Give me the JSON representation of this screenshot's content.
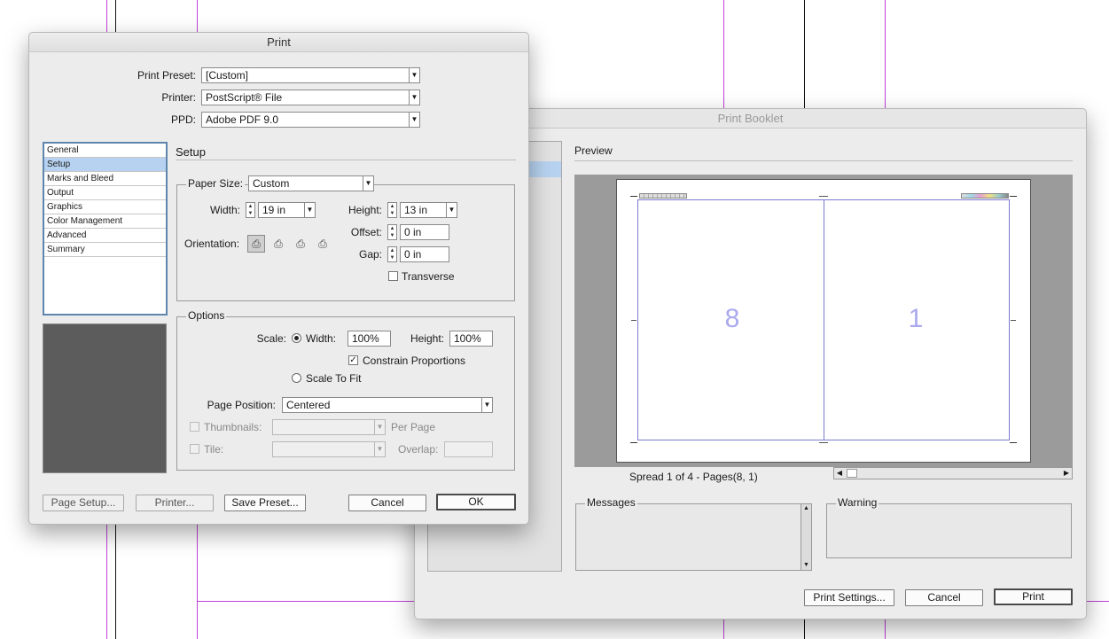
{
  "print": {
    "title": "Print",
    "preset_label": "Print Preset:",
    "preset_value": "[Custom]",
    "printer_label": "Printer:",
    "printer_value": "PostScript® File",
    "ppd_label": "PPD:",
    "ppd_value": "Adobe PDF 9.0",
    "categories": [
      "General",
      "Setup",
      "Marks and Bleed",
      "Output",
      "Graphics",
      "Color Management",
      "Advanced",
      "Summary"
    ],
    "selected_category": "Setup",
    "section_title": "Setup",
    "paper_size_label": "Paper Size:",
    "paper_size_value": "Custom",
    "width_label": "Width:",
    "width_value": "19 in",
    "height_label": "Height:",
    "height_value": "13 in",
    "orientation_label": "Orientation:",
    "offset_label": "Offset:",
    "offset_value": "0 in",
    "gap_label": "Gap:",
    "gap_value": "0 in",
    "transverse_label": "Transverse",
    "options_title": "Options",
    "scale_label": "Scale:",
    "scale_width_label": "Width:",
    "scale_width_value": "100%",
    "scale_height_label": "Height:",
    "scale_height_value": "100%",
    "constrain_label": "Constrain Proportions",
    "scale_to_fit_label": "Scale To Fit",
    "page_position_label": "Page Position:",
    "page_position_value": "Centered",
    "thumbnails_label": "Thumbnails:",
    "per_page_label": "Per Page",
    "tile_label": "Tile:",
    "overlap_label": "Overlap:",
    "buttons": {
      "page_setup": "Page Setup...",
      "printer": "Printer...",
      "save_preset": "Save Preset...",
      "cancel": "Cancel",
      "ok": "OK"
    }
  },
  "booklet": {
    "title": "Print Booklet",
    "preview_label": "Preview",
    "left_page_number": "8",
    "right_page_number": "1",
    "spread_status": "Spread 1 of 4 - Pages(8, 1)",
    "messages_label": "Messages",
    "warning_label": "Warning",
    "buttons": {
      "print_settings": "Print Settings...",
      "cancel": "Cancel",
      "print": "Print"
    }
  },
  "colors": {
    "guide_pink": "#c040d8",
    "selection_blue": "#b7d2f0",
    "preview_bg": "#9b9b9b",
    "page_number": "#a9a9ee"
  }
}
